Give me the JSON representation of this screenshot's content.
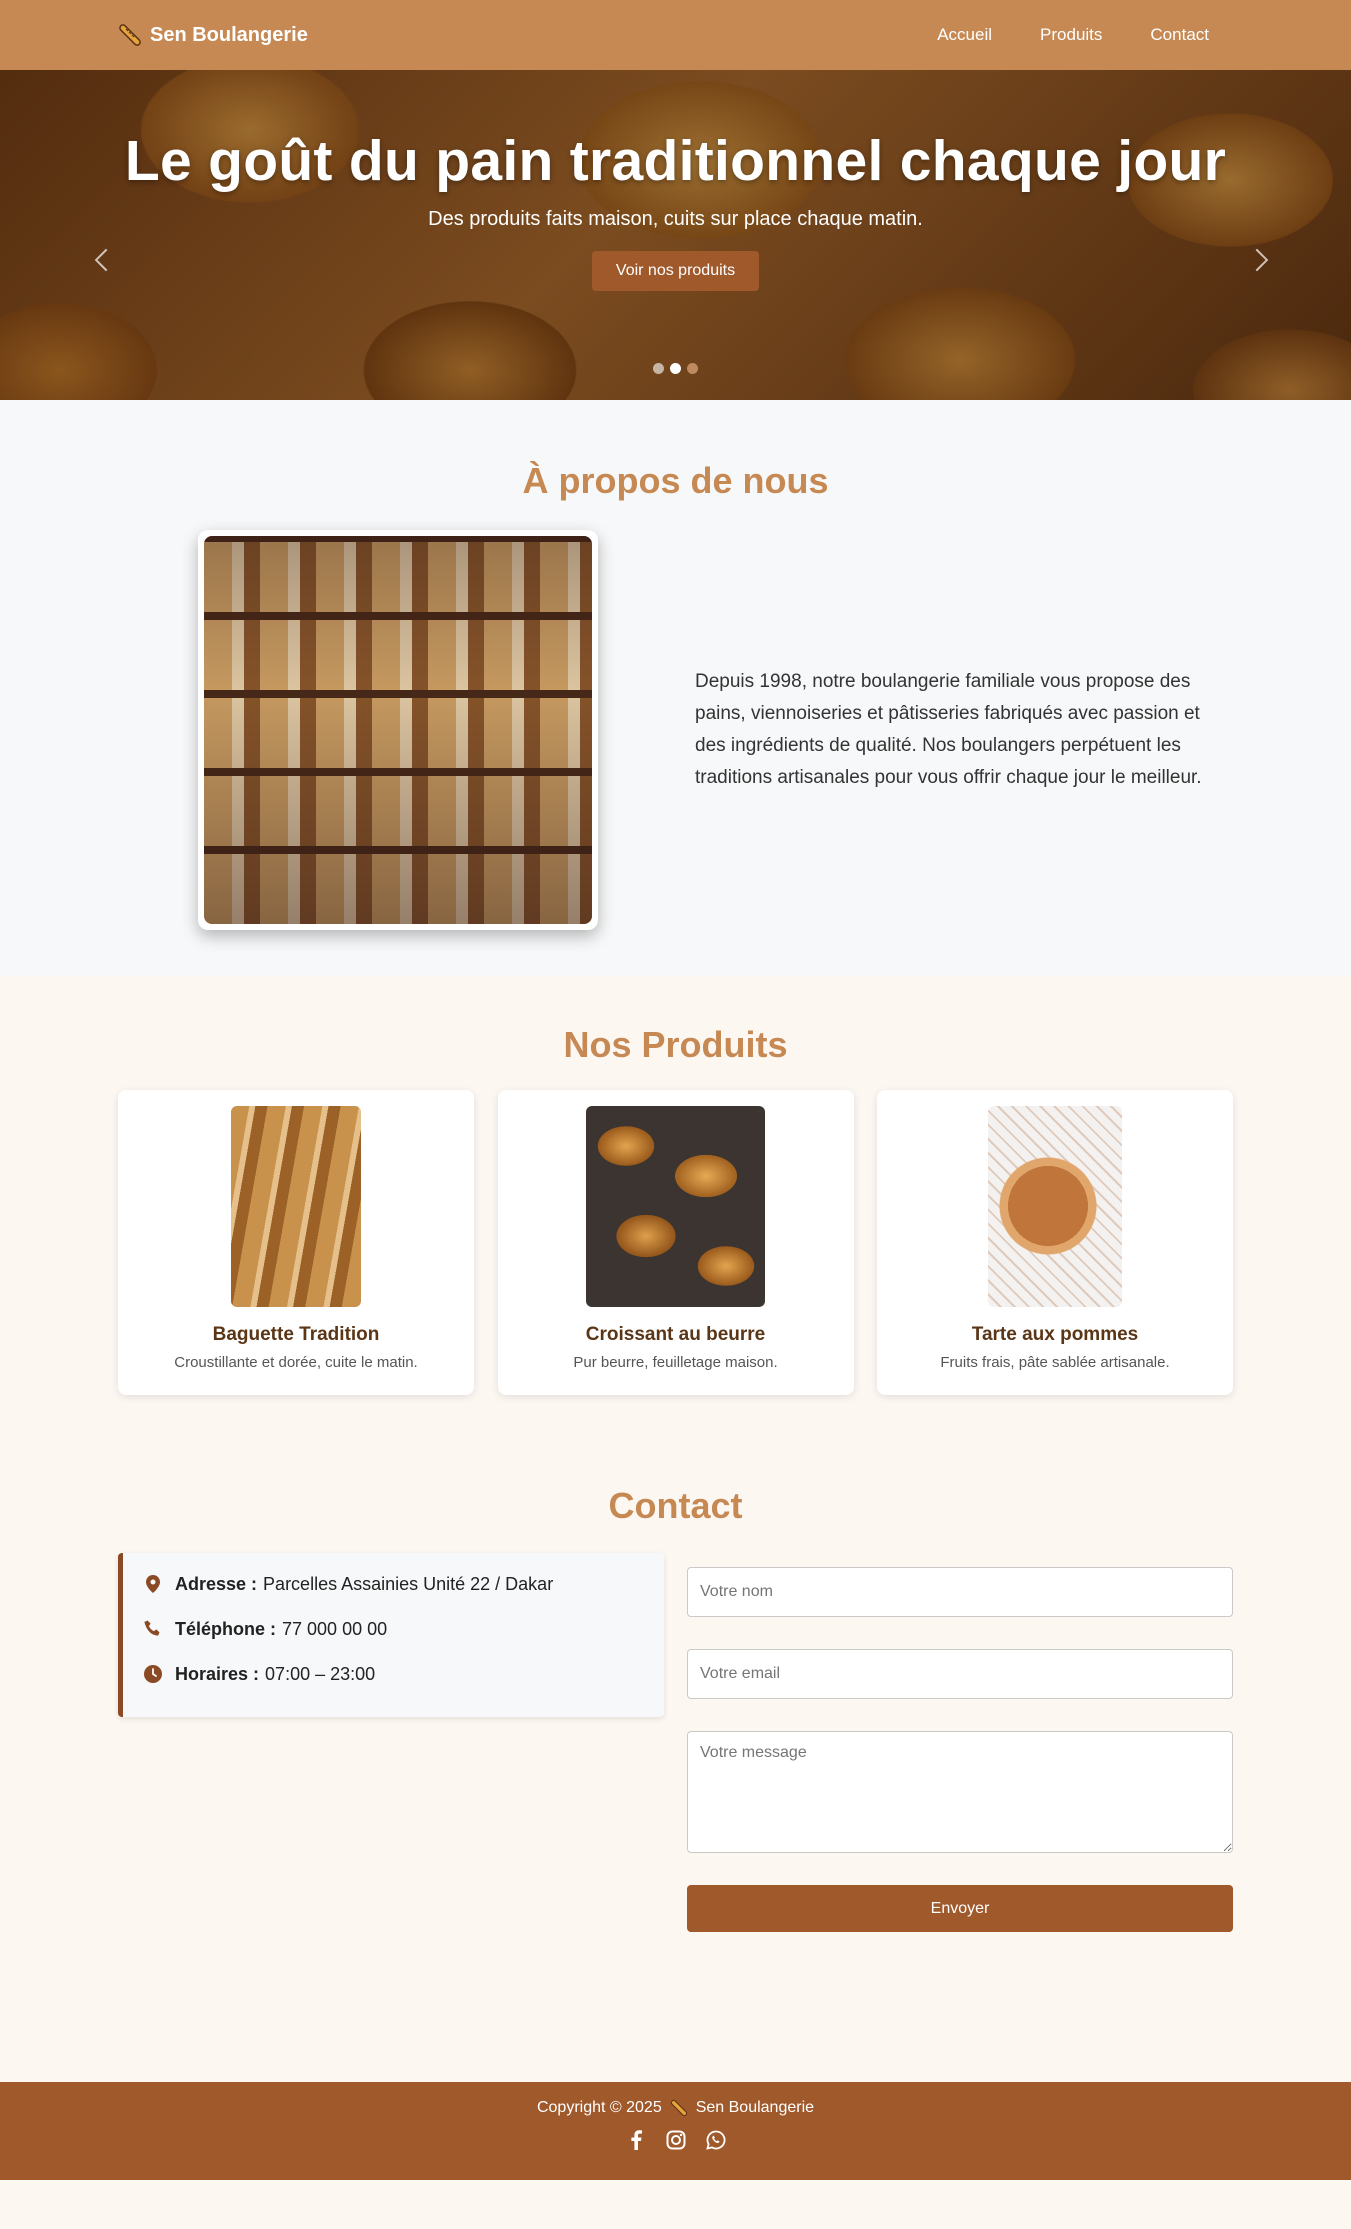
{
  "nav": {
    "brand": "Sen Boulangerie",
    "brand_icon": "baguette-icon",
    "links": [
      "Accueil",
      "Produits",
      "Contact"
    ]
  },
  "hero": {
    "title": "Le goût du pain traditionnel chaque jour",
    "subtitle": "Des produits faits maison, cuits sur place chaque matin.",
    "button": "Voir nos produits",
    "slide_count": 3,
    "active_slide": 2
  },
  "about": {
    "title": "À propos de nous",
    "text": "Depuis 1998, notre boulangerie familiale vous propose des pains, viennoiseries et pâtisseries fabriqués avec passion et des ingrédients de qualité. Nos boulangers perpétuent les traditions artisanales pour vous offrir chaque jour le meilleur."
  },
  "products": {
    "title": "Nos Produits",
    "items": [
      {
        "name": "Baguette Tradition",
        "desc": "Croustillante et dorée, cuite le matin."
      },
      {
        "name": "Croissant au beurre",
        "desc": "Pur beurre, feuilletage maison."
      },
      {
        "name": "Tarte aux pommes",
        "desc": "Fruits frais, pâte sablée artisanale."
      }
    ]
  },
  "contact": {
    "title": "Contact",
    "address_label": "Adresse :",
    "address": "Parcelles Assainies Unité 22 / Dakar",
    "phone_label": "Téléphone :",
    "phone": "77 000 00 00",
    "hours_label": "Horaires :",
    "hours": "07:00 – 23:00",
    "name_placeholder": "Votre nom",
    "email_placeholder": "Votre email",
    "message_placeholder": "Votre message",
    "send": "Envoyer"
  },
  "footer": {
    "copyright": "Copyright © 2025",
    "brand": "Sen Boulangerie",
    "socials": [
      "facebook-icon",
      "instagram-icon",
      "whatsapp-icon"
    ]
  },
  "colors": {
    "primary": "#c68953",
    "secondary": "#a0592b",
    "dark_brown": "#8b4a26",
    "title_brown": "#5a3516"
  }
}
